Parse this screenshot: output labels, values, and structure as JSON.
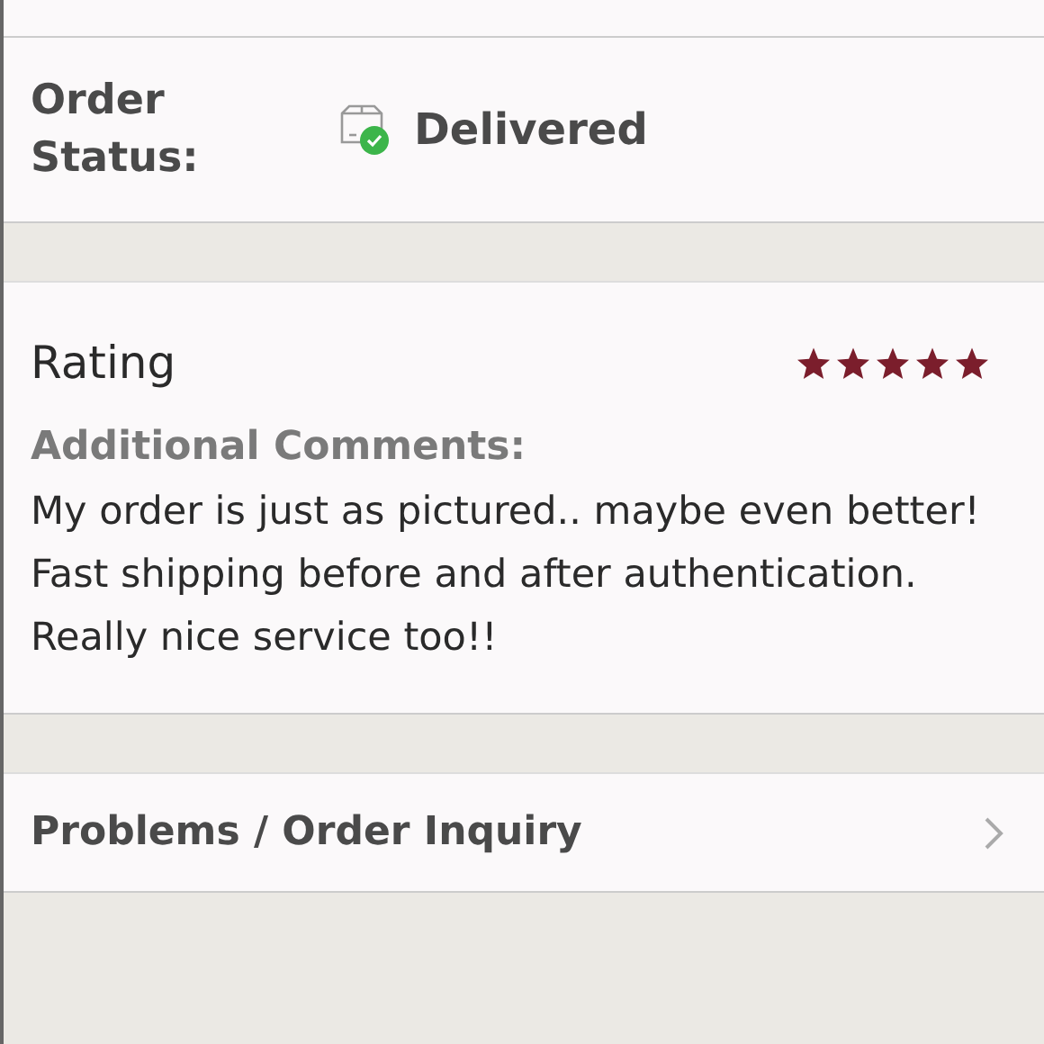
{
  "order_status": {
    "label": "Order Status:",
    "value": "Delivered",
    "delivered": true
  },
  "rating": {
    "label": "Rating",
    "stars": 5,
    "comments_label": "Additional Comments:",
    "comments": "My order is just as pictured.. maybe even better! Fast shipping before and after authentication. Really nice service too!!"
  },
  "inquiry": {
    "label": "Problems / Order Inquiry"
  }
}
